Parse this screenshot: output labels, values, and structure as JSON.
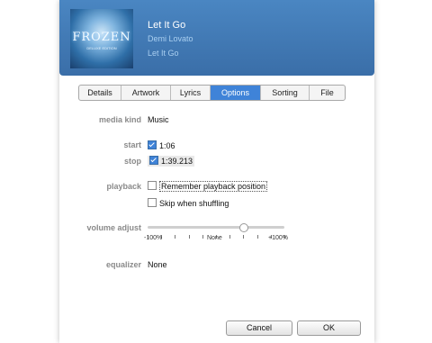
{
  "track": {
    "title": "Let It Go",
    "artist": "Demi Lovato",
    "album": "Let It Go"
  },
  "artwork": {
    "title_text": "FROZEN",
    "edition_text": "DELUXE EDITION"
  },
  "tabs": [
    {
      "label": "Details",
      "active": false
    },
    {
      "label": "Artwork",
      "active": false
    },
    {
      "label": "Lyrics",
      "active": false
    },
    {
      "label": "Options",
      "active": true
    },
    {
      "label": "Sorting",
      "active": false
    },
    {
      "label": "File",
      "active": false
    }
  ],
  "options": {
    "media_kind": {
      "label": "media kind",
      "value": "Music"
    },
    "start": {
      "label": "start",
      "checked": true,
      "value": "1:06"
    },
    "stop": {
      "label": "stop",
      "checked": true,
      "value": "1:39.213"
    },
    "playback": {
      "label": "playback",
      "remember": {
        "label": "Remember playback position",
        "checked": false
      },
      "skip": {
        "label": "Skip when shuffling",
        "checked": false
      }
    },
    "volume": {
      "label": "volume adjust",
      "min_label": "-100%",
      "mid_label": "None",
      "max_label": "+100%",
      "level": 0.7
    },
    "equalizer": {
      "label": "equalizer",
      "value": "None"
    }
  },
  "buttons": {
    "cancel": "Cancel",
    "ok": "OK"
  },
  "colors": {
    "header": "#3a6ea8",
    "accent": "#3f83d8"
  }
}
